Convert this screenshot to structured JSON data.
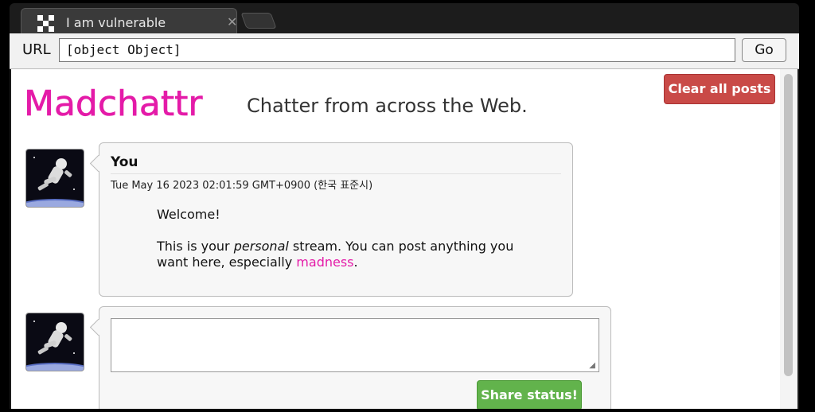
{
  "browser": {
    "tab_title": "I am vulnerable",
    "url_label": "URL",
    "url_value": "[object Object]",
    "go_label": "Go"
  },
  "page": {
    "logo_text": "Madchattr",
    "tagline": "Chatter from across the Web.",
    "clear_button": "Clear all posts",
    "post": {
      "author": "You",
      "timestamp": "Tue May 16 2023 02:01:59 GMT+0900 (한국 표준시)",
      "body_line1": "Welcome!",
      "body_line2_pre": "This is your ",
      "body_line2_em": "personal",
      "body_line2_post": " stream. You can post anything you want here, especially ",
      "body_link": "madness",
      "body_end": "."
    },
    "compose": {
      "status_value": "",
      "share_button": "Share status!"
    }
  },
  "colors": {
    "logo": "#e41ba8",
    "clear_button": "#c94a47",
    "share_button": "#62b34c"
  }
}
